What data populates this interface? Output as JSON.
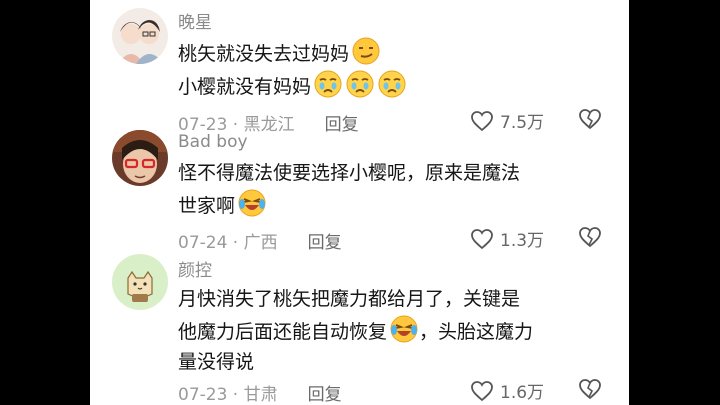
{
  "comments": [
    {
      "username": "晚星",
      "lines": [
        "桃矢就没失去过妈妈",
        "小樱就没有妈妈"
      ],
      "emojis": [
        "smirk-emoji",
        "teary-emoji",
        "teary-emoji",
        "teary-emoji"
      ],
      "date": "07-23",
      "location": "黑龙江",
      "reply_label": "回复",
      "likes": "7.5万"
    },
    {
      "username": "Bad boy",
      "lines": [
        "怪不得魔法使要选择小樱呢，原来是魔法",
        "世家啊"
      ],
      "emojis": [
        "laughing-crying-emoji"
      ],
      "date": "07-24",
      "location": "广西",
      "reply_label": "回复",
      "likes": "1.3万"
    },
    {
      "username": "颜控",
      "lines": [
        "月快消失了桃矢把魔力都给月了，关键是",
        "他魔力后面还能自动恢复",
        "，头胎这魔力",
        "量没得说"
      ],
      "emojis": [
        "laughing-crying-emoji"
      ],
      "date": "07-23",
      "location": "甘肃",
      "reply_label": "回复",
      "likes": "1.6万"
    }
  ],
  "separator": " · "
}
